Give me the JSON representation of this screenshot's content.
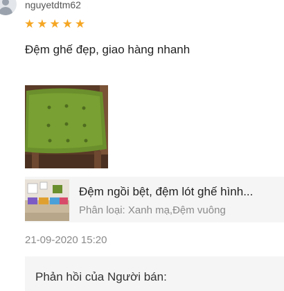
{
  "review": {
    "username": "nguyetdtm62",
    "rating": 5,
    "comment": "Đệm ghế đẹp, giao hàng nhanh",
    "timestamp": "21-09-2020 15:20"
  },
  "product": {
    "name": "Đệm ngồi bệt, đệm lót ghế hình...",
    "variant": "Phân loại: Xanh mạ,Đệm vuông"
  },
  "seller_reply": {
    "title": "Phản hồi của Người bán:"
  },
  "colors": {
    "star": "#f5a623",
    "cushion_green": "#6b8f2c"
  },
  "icons": {
    "avatar": "user-avatar-icon",
    "star": "star-icon"
  }
}
